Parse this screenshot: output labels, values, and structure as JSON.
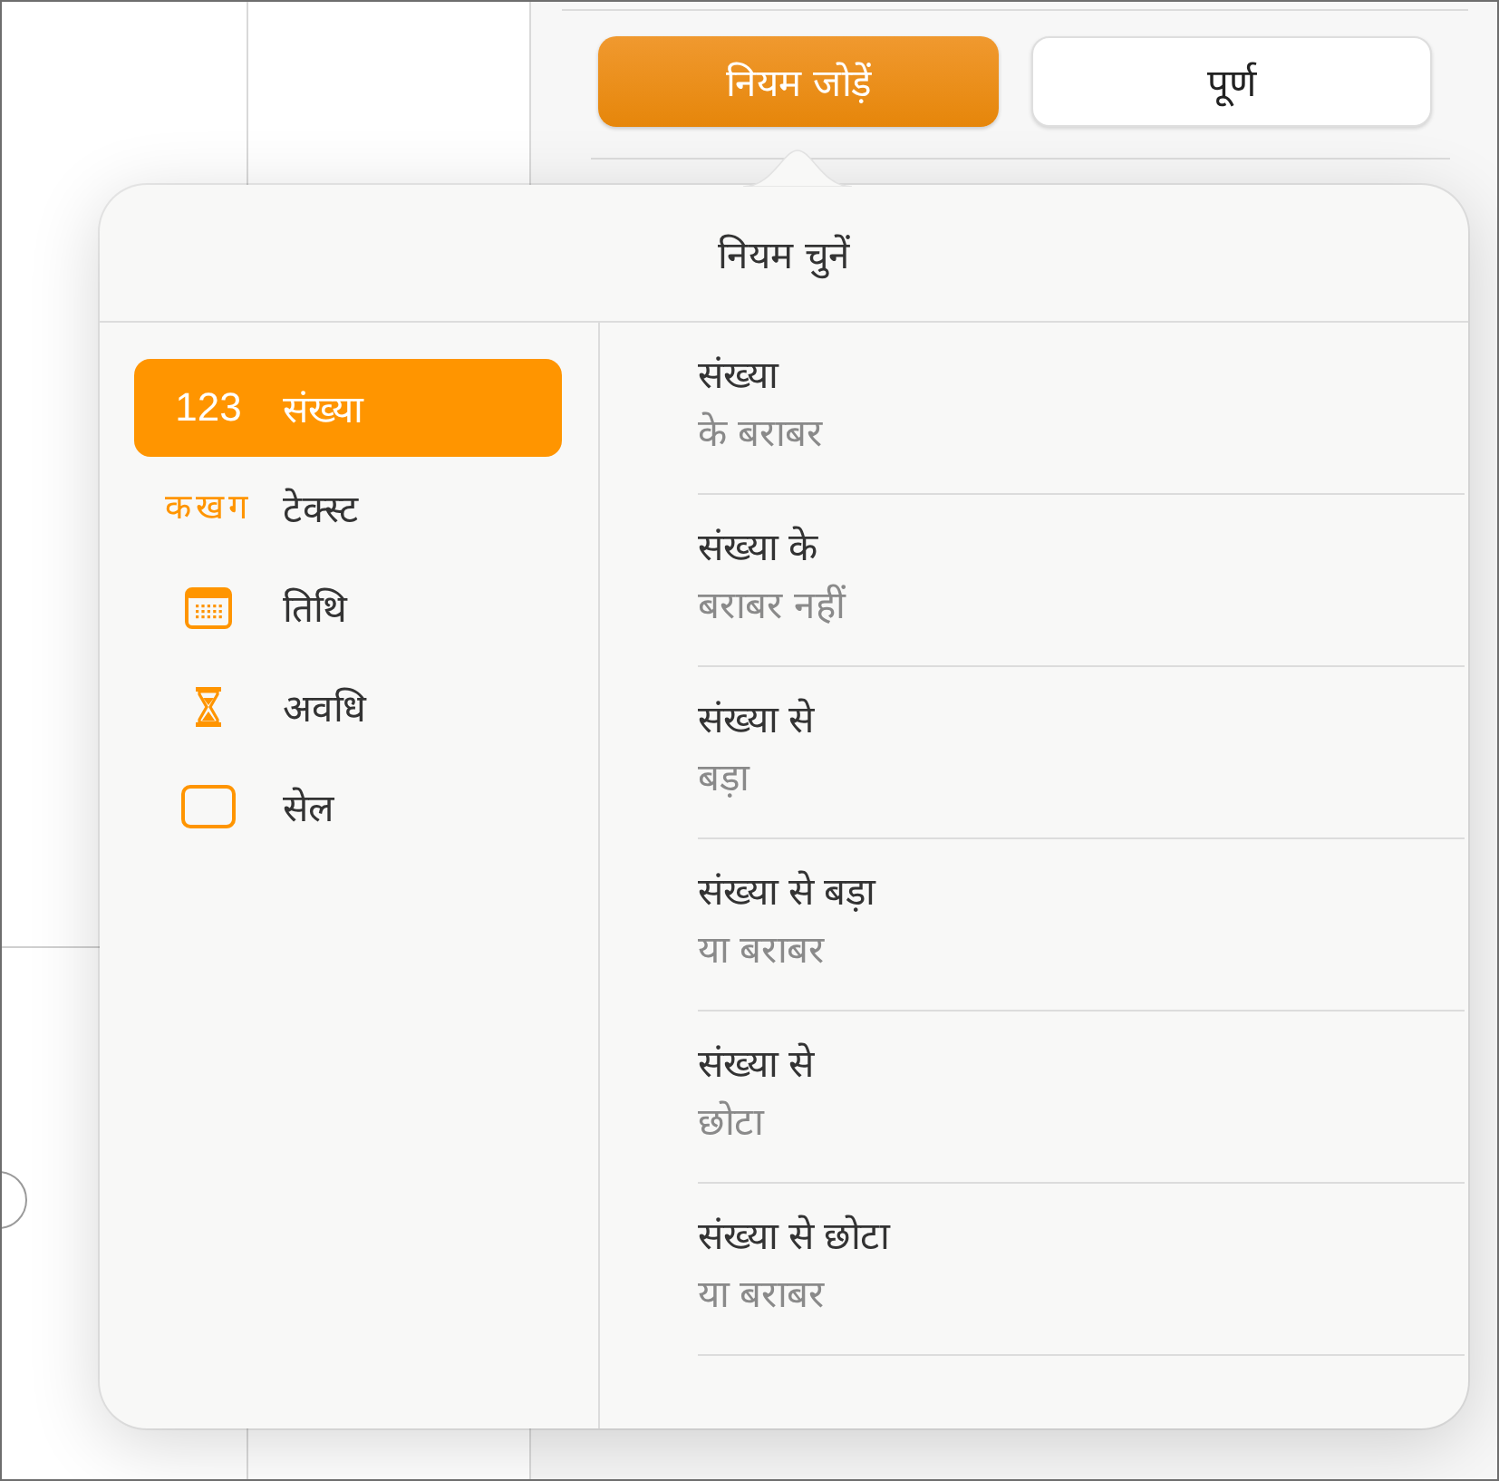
{
  "toolbar": {
    "buttons": [
      {
        "label": "नियम जोड़ें",
        "kind": "primary"
      },
      {
        "label": "पूर्ण",
        "kind": "secondary"
      }
    ]
  },
  "popover": {
    "title": "नियम चुनें",
    "categories": [
      {
        "kind": "number",
        "glyph": "123",
        "label": "संख्या",
        "selected": true
      },
      {
        "kind": "text",
        "glyph": "कखग",
        "label": "टेक्स्ट",
        "selected": false
      },
      {
        "kind": "date",
        "label": "तिथि",
        "selected": false
      },
      {
        "kind": "duration",
        "label": "अवधि",
        "selected": false
      },
      {
        "kind": "cell",
        "label": "सेल",
        "selected": false
      }
    ],
    "rules": [
      {
        "title": "संख्या",
        "subtitle": "के बराबर"
      },
      {
        "title": "संख्या के",
        "subtitle": "बराबर नहीं"
      },
      {
        "title": "संख्या से",
        "subtitle": "बड़ा"
      },
      {
        "title": "संख्या से बड़ा",
        "subtitle": "या बराबर"
      },
      {
        "title": "संख्या से",
        "subtitle": "छोटा"
      },
      {
        "title": "संख्या से छोटा",
        "subtitle": "या बराबर"
      }
    ]
  }
}
